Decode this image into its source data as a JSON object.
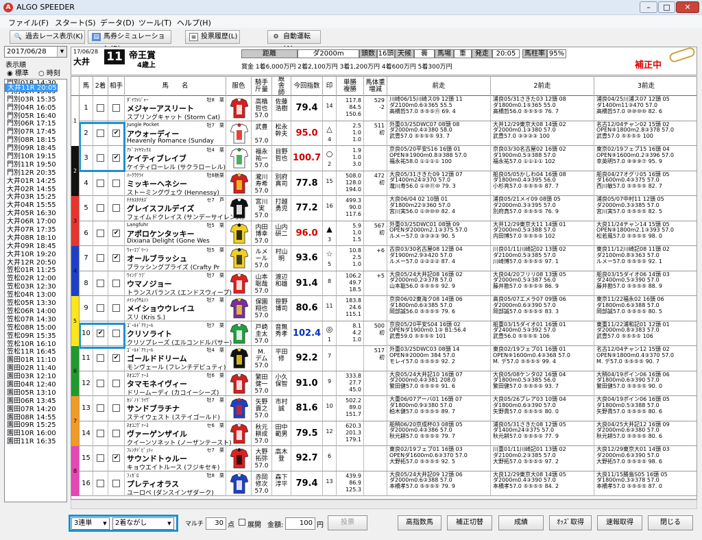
{
  "window": {
    "title": "ALGO SPEEDER"
  },
  "menu": [
    "ファイル(F)",
    "スタート(S)",
    "データ(D)",
    "ツール(T)",
    "ヘルプ(H)"
  ],
  "toolbar": {
    "past": "過去レース表示(K)",
    "sim": "馬券シミュレーション(B)",
    "history": "投票履歴(L)",
    "auto": "自動運転(A)"
  },
  "left": {
    "date": "2017/06/28",
    "order_label": "表示順",
    "opt1": "標準",
    "opt2": "時刻",
    "races": [
      "門別01R 14:30",
      "門別02R 15:05",
      "門別03R 15:35",
      "門別04R 16:05",
      "門別05R 16:40",
      "門別06R 17:15",
      "門別07R 17:45",
      "門別08R 18:15",
      "門別09R 18:45",
      "門別10R 19:15",
      "門別11R 19:50",
      "門別12R 20:35",
      "大井01R 14:25",
      "大井02R 14:55",
      "大井03R 15:25",
      "大井04R 15:55",
      "大井05R 16:30",
      "大井06R 17:00",
      "大井07R 17:35",
      "大井08R 18:10",
      "大井09R 18:45",
      "大井10R 19:20",
      "大井11R 20:05",
      "大井12R 20:50",
      "笠松01R 11:25",
      "笠松02R 12:00",
      "笠松03R 12:30",
      "笠松04R 13:00",
      "笠松05R 13:30",
      "笠松06R 14:00",
      "笠松07R 14:30",
      "笠松08R 15:00",
      "笠松09R 15:35",
      "笠松10R 16:10",
      "笠松11R 16:45",
      "園田01R 11:10",
      "園田02R 11:40",
      "園田03R 12:10",
      "園田04R 12:40",
      "園田05R 13:10",
      "園田06R 13:45",
      "園田07R 14:20",
      "園田08R 14:55",
      "園田09R 15:25",
      "園田10R 16:00",
      "園田11R 16:35"
    ],
    "selected": 22
  },
  "race": {
    "date": "17/06/28",
    "venue": "大井",
    "num": "11",
    "name": "帝王賞",
    "cond": "4歳上",
    "dist_l": "距離",
    "dist": "ダ2000m",
    "heads_l": "頭数",
    "heads": "16頭",
    "weather_l": "天候",
    "weather": "曇",
    "track_l": "馬場",
    "track": "重",
    "post_l": "発走",
    "post": "20:05",
    "rate_l": "馬柱率",
    "rate": "95%",
    "prize": "賞金 1着6,000万円 2着2,100万円 3着1,200万円 4着600万円 5着300万円",
    "hosei": "補正中"
  },
  "headers": {
    "waku": "",
    "uma": "馬",
    "nicha": "2着",
    "aite": "相手",
    "name": "馬　　名",
    "color": "服色",
    "jockey": "騎手\n斤量",
    "trainer": "厩\n舎\n師",
    "idx": "今回指数",
    "mark": "印",
    "odds": "単勝\n複勝",
    "weight": "馬体重\n増減",
    "prev1": "前走",
    "prev2": "2前走",
    "prev3": "3前走"
  },
  "horses": [
    {
      "no": "1",
      "w": "1",
      "c2": false,
      "ca": false,
      "sire": "ﾀﾞｲﾜﾒｼﾞｬｰ",
      "name": "メジャーアスリート",
      "dam": "スプリングキャット (Storm Cat)",
      "sex": "牡8",
      "col": "栗",
      "jock": "高橋\n哲也\n57.0",
      "tr": "佐藤\n浩樹",
      "idx": "79.4",
      "ic": "#000",
      "mk": "",
      "pop": "14",
      "odds": "117.8\n84.5\n150.6",
      "wt": "529\n-2",
      "silk": "s1",
      "p1": [
        "川崎06/15川崎ス09 12頭 11",
        "ダ2100m0.6③365 55.5",
        "高橋哲57.0 ⑤⑤⑤⑪ 69. 4"
      ],
      "p2": [
        "浦良05/31さきた03 12頭 08",
        "ダ1800m0.1⑤365 55.0",
        "高橋哲56.0 ⑤⑤⑤⑤ 76. 7"
      ],
      "p3": [
        "浦良04/25川浦ス07 12頭 05",
        "ダ1400m11③470 57.0",
        "高橋哲57.0 ⑩⑩⑩⑩ 82. 6"
      ]
    },
    {
      "no": "2",
      "w": "1",
      "c2": false,
      "ca": true,
      "sire": "Jungle Pocket",
      "name": "アウォーディー",
      "dam": "Heavenly Romance (Sunday",
      "sex": "牡7",
      "col": "栗",
      "jock": "武豊\n\n57.0",
      "tr": "松永\n幹夫",
      "idx": "95.0",
      "ic": "#d00000",
      "mk": "△",
      "pop": "4",
      "odds": "2.5\n1.0\n1.0",
      "wt": "511\n初",
      "silk": "s2",
      "p1": [
        "外重03/25DWC07 08頭 08",
        "ダ2000m0.4③380 58.0",
        "武豊57.0 ⑤⑤⑤⑤ 93. 7"
      ],
      "p2": [
        "大井12/29東京大08 14頭 02",
        "ダ2000m0.1③380 57.0",
        "武豊57.0 ③③③③ 100"
      ],
      "p3": [
        "名古12/04チャン02 15頭 02",
        "OPEN⑨1800m2.8③378 57.0",
        "武豊57.0 ⑤⑤⑤⑤ 100"
      ]
    },
    {
      "no": "3",
      "w": "2",
      "c2": false,
      "ca": true,
      "sire": "ｱﾄﾞﾏｲﾔﾏｯｸｽ",
      "name": "ケイティブレイブ",
      "dam": "ケイティローレル (サクラローレル)",
      "sex": "牡4",
      "col": "栗",
      "jock": "福永\n祐一\n57.0",
      "tr": "目野\n哲也",
      "idx": "100.7",
      "ic": "#d00000",
      "mk": "○",
      "pop": "2",
      "odds": "1.9\n1.0\n3.0",
      "wt": "",
      "silk": "s3",
      "p1": [
        "京良05/20平安S16 16頭 01",
        "OPEN⑨1900m0.8③388 57.0",
        "福永祐58.0 ①①①① 100"
      ],
      "p2": [
        "京良03/30名古屋02 16頭 02",
        "ダ1900m0.5③388 57.0",
        "福永祐57.0 ①①①① 102"
      ],
      "p3": [
        "東京02/19フェブ15 16頭 04",
        "OPEN⑨1600m0.2③396 57.0",
        "幸英明57.0 ⑨⑨⑨⑦ 95. 9"
      ]
    },
    {
      "no": "4",
      "w": "2",
      "c2": false,
      "ca": false,
      "sire": "ﾊｰｸｳｸﾗｲ",
      "name": "ミッキーヘネシー",
      "dam": "ストーミングヴェウ (Hennessy)",
      "sex": "牡8",
      "col": "栃栗",
      "jock": "瀧川\n寿希\n57.0",
      "tr": "別府\n真司",
      "idx": "77.8",
      "ic": "#000",
      "mk": "",
      "pop": "15",
      "odds": "508.0\n128.0\n194.0",
      "wt": "472\n初",
      "silk": "s4",
      "p1": [
        "大良05/31さきた09 12頭 07",
        "ダ1400m24③370 57.0",
        "瀧川寿56.0 ①⑩⑪⑩ 79. 3"
      ],
      "p2": [
        "船良05/05かしわ04 16頭 08",
        "ダ1800m0.4③395 56.0",
        "小杉亮57.0 ⑤⑤⑤⑤ 87. 7"
      ],
      "p3": [
        "船良04/27オグリ05 16頭 05",
        "ダ1600m0.4③375 57.0",
        "西川敏57.0 ⑤⑤⑤⑤ 82. 7"
      ]
    },
    {
      "no": "5",
      "w": "3",
      "c2": false,
      "ca": false,
      "sire": "ﾁﾁｶｽﾀﾁｶｽﾞ",
      "name": "グレイスフルデイズ",
      "dam": "フェイムドクレイス (サンデーサイレンス)",
      "sex": "セ7",
      "col": "芦",
      "jock": "宮川\n実\n57.0",
      "tr": "打越\n勇児",
      "idx": "77.2",
      "ic": "#000",
      "mk": "",
      "pop": "16",
      "odds": "499.3\n90.0\n117.6",
      "wt": "",
      "silk": "s5",
      "p1": [
        "大良06/04 02 10頭 01",
        "ダ1800m22③360 57.0",
        "宮川実56.0 ①⑩⑩⑩ 82. 4"
      ],
      "p2": [
        "浦良05/21メイ09 08頭 05",
        "ダ2000m0.3③395 57.0",
        "別府真57.0 ⑤⑤⑤⑤ 76. 9"
      ],
      "p3": [
        "浦良05/07中村11 12頭 05",
        "ダ2000m0.3③385 57.0",
        "宮川実57.0 ⑤⑤⑤⑤ 82. 5"
      ]
    },
    {
      "no": "6",
      "w": "3",
      "c2": false,
      "ca": true,
      "sire": "Langfuhr",
      "name": "アポロケンタッキー",
      "dam": "Dixiana Delight (Gone Wes",
      "sex": "牡5",
      "col": "栗",
      "jock": "内田\n博幸\n57.0",
      "tr": "山内\n研二",
      "idx": "96.0",
      "ic": "#d00000",
      "mk": "▲",
      "pop": "3",
      "odds": "5.9\n1.0\n1.5",
      "wt": "567\n初",
      "silk": "s6",
      "p1": [
        "外重03/25DWC01 08頭 09",
        "OPENダ2000m2.1③375 57.0",
        "ルメー57.0 ③③③③ 90. 5"
      ],
      "p2": [
        "大井12/29東京大11 14頭 01",
        "ダ2000m0.5③388 57.0",
        "内田博57.0 ⑤⑤⑤⑤ 102"
      ],
      "p3": [
        "大良11/24チャン14 15頭 05",
        "OPEN⑨1800m2.1③393 57.0",
        "松若風57.0 ⑤⑤⑤⑤ 98. 0"
      ]
    },
    {
      "no": "7",
      "w": "4",
      "c2": false,
      "ca": true,
      "sire": "ｳｫｰｴﾌﾞﾘｰﾝ",
      "name": "オールブラッシュ",
      "dam": "ブラッシングプライズ (Crafty Pr",
      "sex": "牡5",
      "col": "栗",
      "jock": "ルメ\nール\n57.0",
      "tr": "村山\n明",
      "idx": "93.6",
      "ic": "#000",
      "mk": "☆",
      "pop": "5",
      "odds": "10.8\n2.5\n1.0",
      "wt": "+6",
      "silk": "s7",
      "p1": [
        "古良03/30名古屋08 12頭 04",
        "ダ1900m2.9③420 57.0",
        "ルメー57.0 ②②②② 87. 4"
      ],
      "p2": [
        "川良01/11川崎記02 13頭 02",
        "ダ2100m0.5③385 57.0",
        "川崎博57.0 ⑤⑤⑤⑤ 97. 1"
      ],
      "p3": [
        "東良11/12川崎記08 11頭 02",
        "ダ2100m0.8③363 57.0",
        "ルメー57.0 ⑤⑤⑤⑤ 92. 1"
      ]
    },
    {
      "no": "8",
      "w": "4",
      "c2": false,
      "ca": false,
      "sire": "ｳｲﾝｸﾞﾗﾌﾞ",
      "name": "ウマノジョー",
      "dam": "トランスパランス (エンドスウィープ)",
      "sex": "牡7",
      "col": "栗",
      "jock": "山本\n聡哉\n57.0",
      "tr": "渡辺\n和雄",
      "idx": "91.4",
      "ic": "#000",
      "mk": "",
      "pop": "8",
      "odds": "106.2\n49.7\n18.5",
      "wt": "+5",
      "silk": "s8",
      "p1": [
        "大良05/24大井記08 16頭 02",
        "ダ2000m0.2③378 57.0",
        "山本聡56.0 ⑤⑤⑤⑤ 92. 9"
      ],
      "p2": [
        "大良04/20フリリ08 13頭 05",
        "ダ2000m0.5③387 56.0",
        "藤井勘57.0 ⑤⑤⑤⑤ 86. 9"
      ],
      "p3": [
        "船良03/15ダイオ06 14頭 03",
        "ダ2400m0.5③390 57.0",
        "藤井勘57.0 ⑤⑤⑤⑤ 88. 9"
      ]
    },
    {
      "no": "9",
      "w": "5",
      "c2": false,
      "ca": false,
      "sire": "ﾒｲｼｮｳｻﾑｿﾝ",
      "name": "メイショウウレイユ",
      "dam": "スリ (Kris S.)",
      "sex": "牡7",
      "col": "栗",
      "jock": "保園\n翔也\n57.0",
      "tr": "笹野\n博司",
      "idx": "80.6",
      "ic": "#000",
      "mk": "",
      "pop": "11",
      "odds": "183.8\n24.6\n115.1",
      "wt": "",
      "silk": "s9",
      "p1": [
        "京良06/02東海ク08 14頭 06",
        "ダ1800m0.6③385 57.0",
        "岡部誠56.0 ⑤⑤⑤⑤ 79. 6"
      ],
      "p2": [
        "高良05/07エメラ07 09頭 06",
        "ダ2000m0.6③390 57.0",
        "岡部誠57.0 ⑤⑤⑤⑤ 83. 3"
      ],
      "p3": [
        "東京11/22福永02 16頭 06",
        "ダ1800m0.6③388 57.0",
        "岡部誠57.0 ⑤⑤⑤⑤ 80. 5"
      ]
    },
    {
      "no": "10",
      "w": "5",
      "c2": true,
      "ca": false,
      "sire": "ｺﾞｰﾙﾄﾞｱﾘｭｰﾙ",
      "name": "クリソライト",
      "dam": "クリソプレーズ (エルコンドルパサー)",
      "sex": "牡7",
      "col": "栗",
      "jock": "戸崎\n圭太\n57.0",
      "tr": "音無\n秀孝",
      "idx": "102.4",
      "ic": "#0030c0",
      "mk": "◎",
      "pop": "1",
      "odds": "8.1\n4.2\n1.0",
      "wt": "500\n初",
      "silk": "s10",
      "p1": [
        "京良05/20平安S04 16頭 02",
        "OPENダ1900m0.1③ B1:56.4",
        "武豊59.0 ⑤⑤⑤⑤ 101"
      ],
      "p2": [
        "船重03/15ダイオ01 16頭 01",
        "ダ2400m0.5③392 57.0",
        "武豊56.0 ⑤⑤⑤⑤ 106"
      ],
      "p3": [
        "東重11/22浦和記01 12頭 01",
        "ダ2000m0.8③383 57.0",
        "武豊57.0 ⑤⑤⑤⑤ 106"
      ]
    },
    {
      "no": "11",
      "w": "6",
      "c2": false,
      "ca": true,
      "sire": "ｺﾞｰﾙﾄﾞｱﾘｭｰﾙ",
      "name": "ゴールドドリーム",
      "dam": "モンヴェール (フレンチデピュティ)",
      "sex": "牡4",
      "col": "栗",
      "jock": "M.\nデム\n57.0",
      "tr": "平田\n修",
      "idx": "92.2",
      "ic": "#000",
      "mk": "",
      "pop": "7",
      "odds": "",
      "wt": "517\n初",
      "silk": "s11",
      "p1": [
        "外重03/25DWC03 08頭 14",
        "OPEN⑨2000m 384 57.0",
        "モレイ57.0 ⑤⑤⑤⑤ 92. 2"
      ],
      "p2": [
        "東良02/19フェブ01 16頭 01",
        "OPEN⑨1600m0.4③368 57.0",
        "M. デ57.0 ⑤⑤⑤⑤ 99. 4"
      ],
      "p3": [
        "名古12/04チャン12 15頭 02",
        "OPEN⑨1800m0.4③370 57.0",
        "M. デ57.0 ⑤⑤⑤⑤ 90. 7"
      ]
    },
    {
      "no": "12",
      "w": "6",
      "c2": false,
      "ca": false,
      "sire": "ﾈｵﾕﾆｳﾞｧｰｽ",
      "name": "タマモネイヴィー",
      "dam": "ドリームーディ (カコイーシーズ)",
      "sex": "牡6",
      "col": "栗",
      "jock": "繁田\n健一\n57.0",
      "tr": "小久\n保智",
      "idx": "91.0",
      "ic": "#000",
      "mk": "",
      "pop": "9",
      "odds": "333.8\n27.7\n45.0",
      "wt": "",
      "silk": "s12",
      "p1": [
        "大良05/24大井記10 16頭 07",
        "ダ2000m0.4③381 208.0",
        "繁田健57.0 ⑤⑤⑤⑤ 91. 6"
      ],
      "p2": [
        "大良05/08ケンタ02 16頭 04",
        "ダ1800m0.5③385 56.0",
        "繁田健57.0 ⑤⑤⑤⑤ 93. 7"
      ],
      "p3": [
        "大稍04/19ポイン06 16頭 06",
        "ダ1800m0.6③390 57.0",
        "繁田健57.0 ⑤⑤⑤⑤ 90. 0"
      ]
    },
    {
      "no": "13",
      "w": "7",
      "c2": false,
      "ca": false,
      "sire": "ｶｼﾞﾉﾄﾞﾗｲｳﾞ",
      "name": "サンドブラチナ",
      "dam": "ステイウェスト (ステイゴールド)",
      "sex": "牡7",
      "col": "栗",
      "jock": "矢野\n貴之\n57.0",
      "tr": "市村\n誠",
      "idx": "81.6",
      "ic": "#000",
      "mk": "",
      "pop": "10",
      "odds": "502.2\n89.0\n151.7",
      "wt": "",
      "silk": "s13",
      "p1": [
        "大重06/07アーバ01 16頭 07",
        "ダ1800m0.9③380 57.0",
        "柏木健57.0 ⑤⑤⑤⑤ 89. 7"
      ],
      "p2": [
        "大良05/26ブレア03 10頭 04",
        "ダ1800m0.6③390 57.0",
        "矢野貴57.0 ⑤⑤⑤⑤ 80. 0"
      ],
      "p3": [
        "大良04/19ポイン06 16頭 05",
        "ダ1800m0.5③388 57.0",
        "矢野貴57.0 ⑤⑤⑤⑤ 80. 6"
      ]
    },
    {
      "no": "14",
      "w": "7",
      "c2": false,
      "ca": false,
      "sire": "ﾈｵﾕﾆｳﾞｧｰｽ",
      "name": "ヴァーゲンザイル",
      "dam": "クイーンソネット (ノーザンテースト)",
      "sex": "セ6",
      "col": "栗",
      "jock": "秋元\n耕成\n57.0",
      "tr": "田中\n範男",
      "idx": "79.5",
      "ic": "#000",
      "mk": "",
      "pop": "12",
      "odds": "620.3\n201.3\n179.1",
      "wt": "",
      "silk": "s14",
      "p1": [
        "船稍06/20京成杯03 08頭 05",
        "ダ2000m0.4③386 57.0",
        "秋元耕57.0 ⑤⑤⑤⑤ 79. 7"
      ],
      "p2": [
        "浦良05/31さきた08 12頭 05",
        "ダ1400m24③375 57.0",
        "秋元耕57.0 ⑤⑤⑤⑤ 77. 9"
      ],
      "p3": [
        "大良04/25大井記12 16頭 09",
        "ダ2000m0.6③380 57.0",
        "秋元耕57.0 ⑤⑤⑤⑤ 80. 6"
      ]
    },
    {
      "no": "15",
      "w": "8",
      "c2": false,
      "ca": true,
      "sire": "ﾌﾚﾝﾁﾃﾞﾋﾟｭﾃｨ",
      "name": "サウンドトゥルー",
      "dam": "キョウエイトルース (フジキセキ)",
      "sex": "セ7",
      "col": "栗",
      "jock": "大野\n拓弥\n57.0",
      "tr": "高木\n登",
      "idx": "92.7",
      "ic": "#000",
      "mk": "",
      "pop": "6",
      "odds": "",
      "wt": "",
      "silk": "s15",
      "p1": [
        "東良02/19フェブ01 16頭 03",
        "OPENダ1600m0.6③370 57.0",
        "大野拓57.0 ⑤⑤⑤⑤ 92. 5"
      ],
      "p2": [
        "川重01/11川崎記01 13頭 02",
        "ダ2100m0.2③385 57.0",
        "大野拓57.0 ⑤⑤⑤⑤ 97. 2"
      ],
      "p3": [
        "大良12/29東京大01 14頭 03",
        "ダ2000m0.6③390 57.0",
        "大野拓57.0 ⑤⑤⑤⑤ 98. 6"
      ]
    },
    {
      "no": "16",
      "w": "8",
      "c2": false,
      "ca": false,
      "sire": "ﾌｨｶﾞﾛ",
      "name": "プレティオラス",
      "dam": "ユーロペ (ダンスインザダーク)",
      "sex": "牡8",
      "col": "栗",
      "jock": "赤岡\n修次\n57.0",
      "tr": "森下\n淳平",
      "idx": "79.4",
      "ic": "#000",
      "mk": "",
      "pop": "13",
      "odds": "439.9\n86.9\n125.3",
      "wt": "",
      "silk": "s16",
      "p1": [
        "大良05/24大井記09 12頭 06",
        "ダ2000m0.6③388 57.0",
        "本橋孝57.0 ⑤⑤⑤⑤ 79. 9"
      ],
      "p2": [
        "大良12/29東京大08 14頭 05",
        "ダ2000m0.4③390 57.0",
        "本橋孝57.0 ⑤⑤⑤⑤ 84. 2"
      ],
      "p3": [
        "大良11/15勝島S05 16頭 05",
        "ダ1800m0.3③378 57.0",
        "本橋孝57.0 ⑤⑤⑤⑤ 87. 0"
      ]
    }
  ],
  "bottom": {
    "bet": "3連単",
    "method": "2着ながし",
    "marti": "マルチ",
    "pts": "30",
    "pts_l": "点",
    "expand": "展開",
    "amount_l": "金額:",
    "amount": "100",
    "yen": "円",
    "vote": "投票",
    "btn1": "高指数馬",
    "btn2": "補正切替",
    "btn3": "成績",
    "btn4": "ｵｯｽﾞ取得",
    "btn5": "速報取得",
    "btn6": "閉じる"
  },
  "colors": {
    "waku": [
      "#ffffff",
      "#111111",
      "#e8342c",
      "#1f3fc8",
      "#ffe61a",
      "#1f9a2c",
      "#f39a24",
      "#e845b6"
    ]
  }
}
